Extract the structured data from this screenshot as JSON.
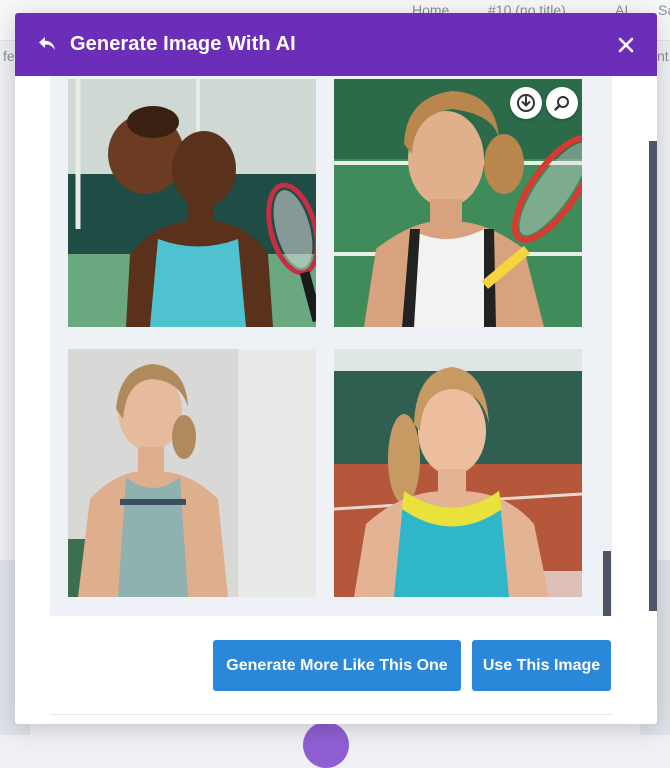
{
  "background": {
    "nav": [
      "Home",
      "#10 (no title)",
      "AI",
      "Sa"
    ],
    "left_fragment": "fe",
    "right_fragment": "nt"
  },
  "modal": {
    "title": "Generate Image With AI",
    "back_icon": "undo-arrow-icon",
    "close_icon": "close-icon",
    "accent_color": "#6c2eb9"
  },
  "gallery": {
    "images": [
      {
        "subject": "tennis player with racket, curly hair"
      },
      {
        "subject": "tennis player swinging racket",
        "actions": [
          "download-icon",
          "zoom-icon"
        ]
      },
      {
        "subject": "player portrait, grey studio"
      },
      {
        "subject": "player on clay court, blue-yellow top"
      }
    ]
  },
  "actions": {
    "generate_more_label": "Generate More Like This One",
    "use_image_label": "Use This Image",
    "button_color": "#2b87da"
  }
}
